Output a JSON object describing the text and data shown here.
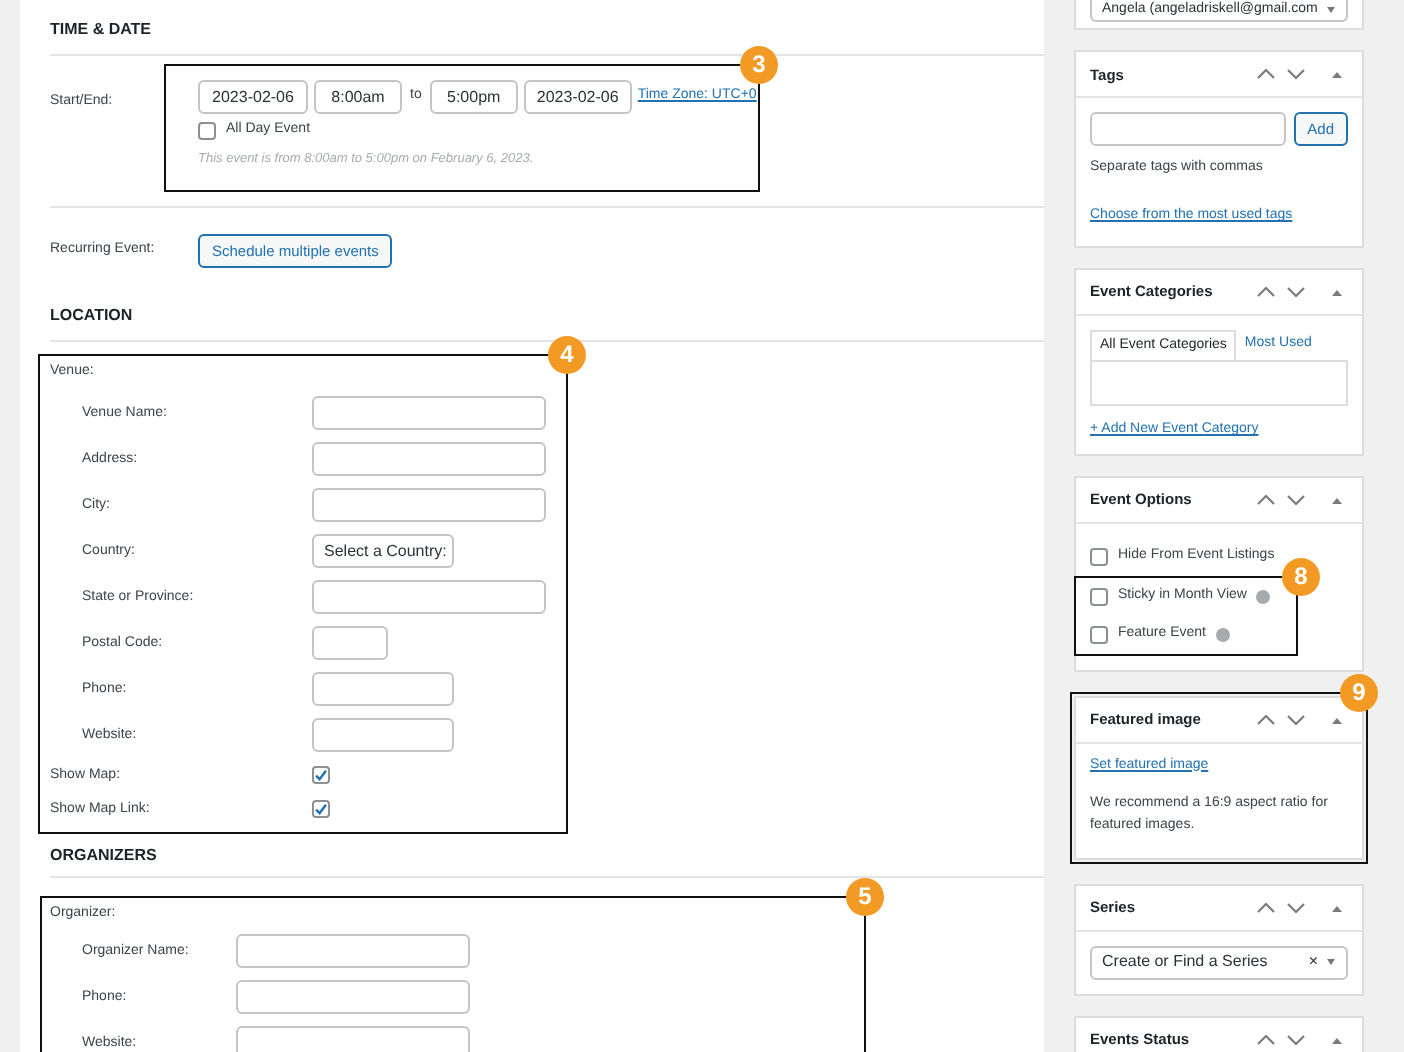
{
  "time_date": {
    "heading": "TIME & DATE",
    "callout": "3",
    "start_end_label": "Start/End:",
    "start_date": "2023-02-06",
    "start_time": "8:00am",
    "to": "to",
    "end_time": "5:00pm",
    "end_date": "2023-02-06",
    "timezone_link": "Time Zone: UTC+0",
    "all_day": {
      "label": "All Day Event",
      "checked": false
    },
    "summary": "This event is from 8:00am to 5:00pm on February 6, 2023.",
    "recurring_label": "Recurring Event:",
    "recurring_button": "Schedule multiple events"
  },
  "location": {
    "heading": "LOCATION",
    "callout": "4",
    "venue_label": "Venue:",
    "fields": [
      {
        "label": "Venue Name:",
        "kind": "wide"
      },
      {
        "label": "Address:",
        "kind": "wide"
      },
      {
        "label": "City:",
        "kind": "wide"
      },
      {
        "label": "Country:",
        "kind": "select",
        "value": "Select a Country:"
      },
      {
        "label": "State or Province:",
        "kind": "wide"
      },
      {
        "label": "Postal Code:",
        "kind": "short"
      },
      {
        "label": "Phone:",
        "kind": "medium"
      },
      {
        "label": "Website:",
        "kind": "medium"
      }
    ],
    "toggles": [
      {
        "label": "Show Map:",
        "checked": true
      },
      {
        "label": "Show Map Link:",
        "checked": true
      }
    ]
  },
  "organizers": {
    "heading": "ORGANIZERS",
    "callout": "5",
    "organizer_label": "Organizer:",
    "fields": [
      {
        "label": "Organizer Name:",
        "kind": "wide"
      },
      {
        "label": "Phone:",
        "kind": "wide"
      },
      {
        "label": "Website:",
        "kind": "wide"
      }
    ]
  },
  "sidebar": {
    "author_select": "Angela (angeladriskell@gmail.com",
    "panels": [
      {
        "kind": "tags",
        "title": "Tags",
        "button": "Add",
        "hint": "Separate tags with commas",
        "link": "Choose from the most used tags"
      },
      {
        "kind": "categories",
        "title": "Event Categories",
        "tabs": [
          {
            "label": "All Event Categories",
            "selected": true
          },
          {
            "label": "Most Used",
            "selected": false
          }
        ],
        "link": "+ Add New Event Category"
      },
      {
        "kind": "options",
        "title": "Event Options",
        "callout": "8",
        "options": [
          {
            "label": "Hide From Event Listings",
            "checked": false,
            "help": false,
            "framed": false
          },
          {
            "label": "Sticky in Month View",
            "checked": false,
            "help": true,
            "framed": true
          },
          {
            "label": "Feature Event",
            "checked": false,
            "help": true,
            "framed": true
          }
        ]
      },
      {
        "kind": "image",
        "title": "Featured image",
        "callout": "9",
        "link": "Set featured image",
        "text": "We recommend a 16:9 aspect ratio for featured images."
      },
      {
        "kind": "series",
        "title": "Series",
        "placeholder": "Create or Find a Series",
        "clear": "×"
      },
      {
        "kind": "status",
        "title": "Events Status"
      }
    ]
  }
}
